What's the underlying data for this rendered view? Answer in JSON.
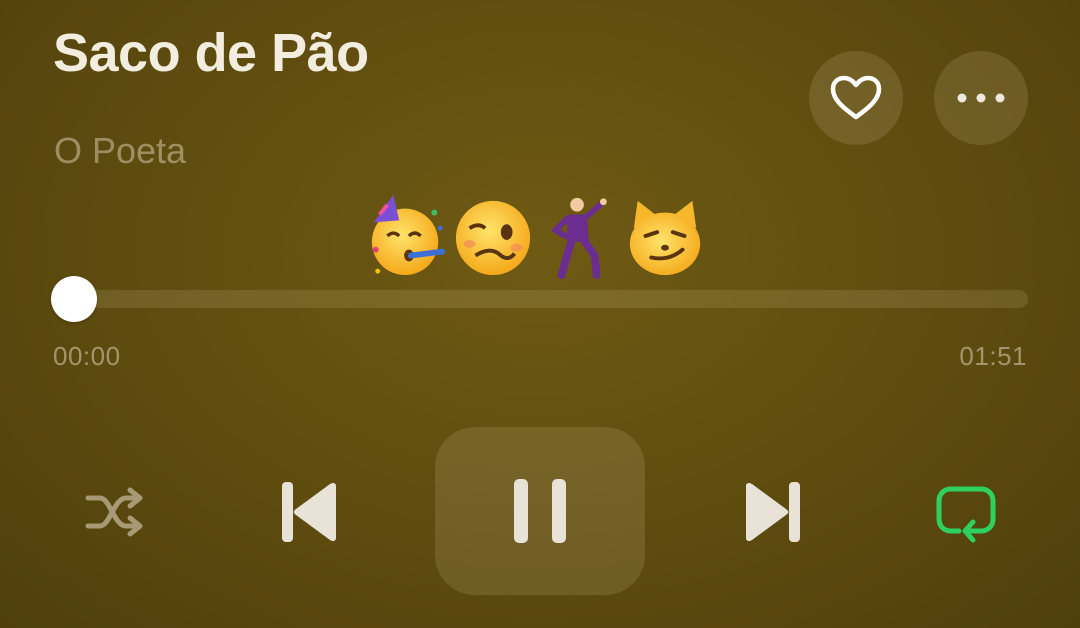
{
  "track": {
    "title": "Saco de Pão",
    "artist": "O Poeta",
    "emojis": [
      "partying-face",
      "woozy-face",
      "man-dancing",
      "smirking-cat-face"
    ]
  },
  "actions": {
    "favorite_icon": "heart-outline-icon",
    "more_icon": "ellipsis-icon"
  },
  "progress": {
    "elapsed": "00:00",
    "total": "01:51",
    "fraction": 0.0
  },
  "controls": {
    "shuffle_icon": "shuffle-icon",
    "previous_icon": "skip-back-icon",
    "play_state": "playing",
    "play_pause_icon": "pause-icon",
    "next_icon": "skip-forward-icon",
    "repeat_icon": "repeat-icon",
    "repeat_active": true
  },
  "colors": {
    "background": "#5e4c0f",
    "repeat_active": "#2ed15f",
    "icon_light": "#e9e2d6",
    "icon_dim": "#a89a74"
  }
}
